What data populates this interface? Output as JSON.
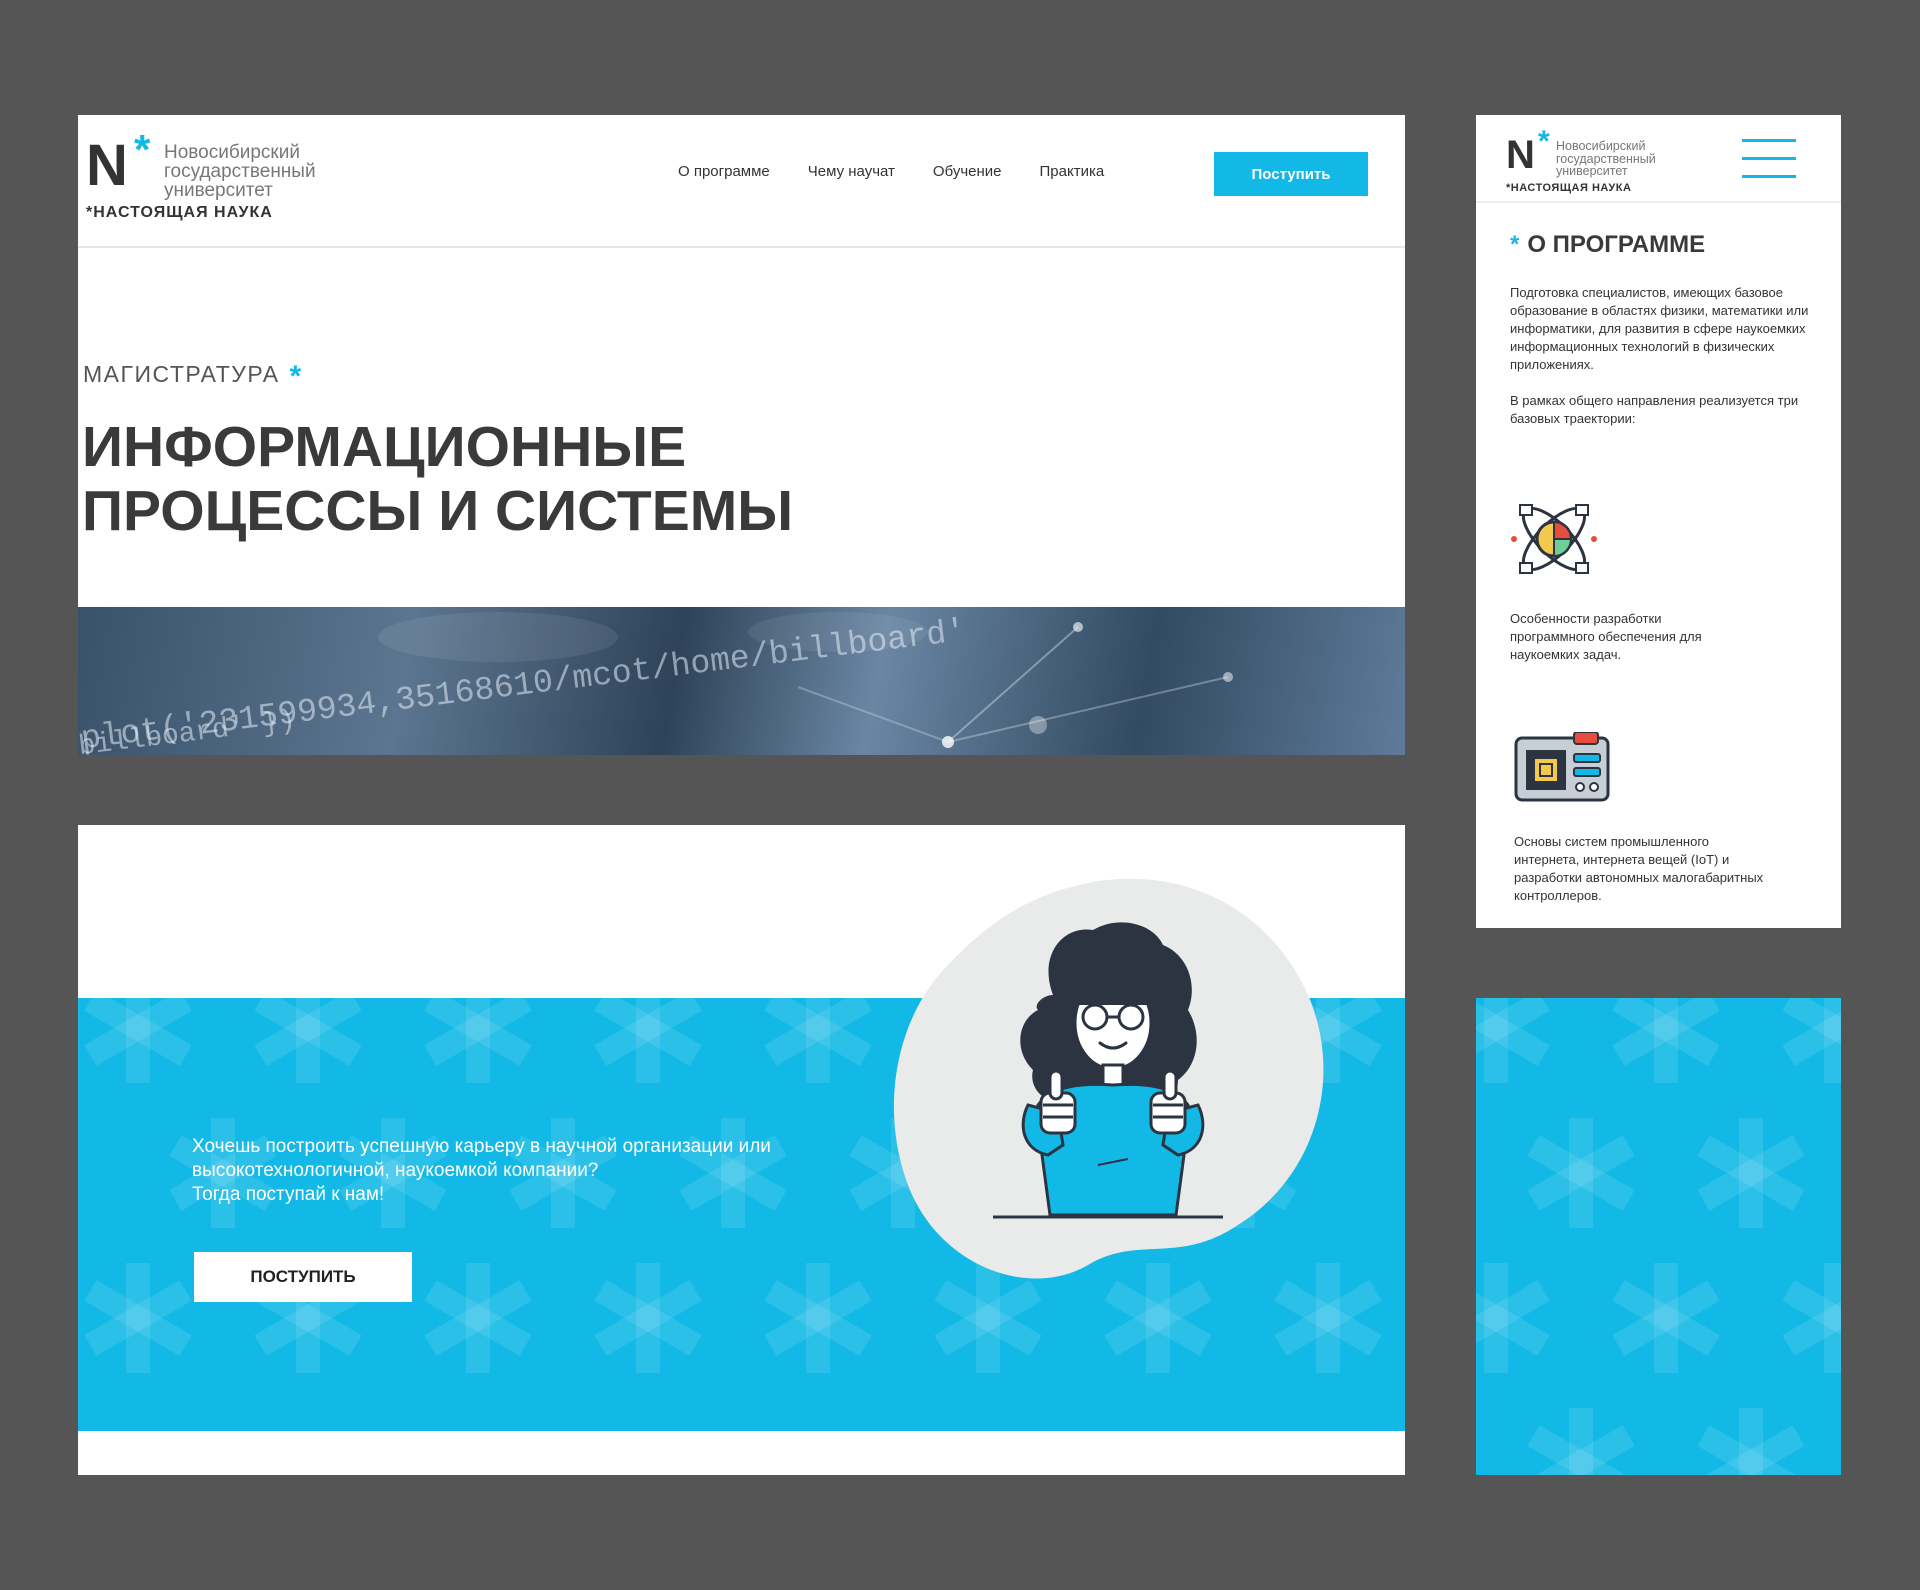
{
  "brand": {
    "logo_letter": "N",
    "logo_star": "*",
    "university_lines": [
      "Новосибирский",
      "государственный",
      "университет"
    ],
    "tagline": "*НАСТОЯЩАЯ НАУКА",
    "accent_color": "#13b9e6"
  },
  "desktop_header": {
    "nav": [
      "О программе",
      "Чему научат",
      "Обучение",
      "Практика"
    ],
    "apply_label": "Поступить"
  },
  "hero": {
    "kicker": "МАГИСТРАТУРА",
    "kicker_star": "*",
    "title_line1": "ИНФОРМАЦИОННЫЕ",
    "title_line2": "ПРОЦЕССЫ И СИСТЕМЫ",
    "code_line1": "plot('231599934,35168610/mcot/home/billboard'",
    "code_line2": "billboard' })"
  },
  "career": {
    "line1": "Хочешь построить успешную карьеру в научной организации или",
    "line2": "высокотехнологичной, наукоемкой компании?",
    "line3": "Тогда поступай к нам!",
    "button_label": "ПОСТУПИТЬ"
  },
  "mobile": {
    "section_star": "*",
    "section_title": "О ПРОГРАММЕ",
    "paragraph1": "Подготовка специалистов, имеющих базовое образование в областях физики, математики или информатики, для развития в сфере наукоемких информационных технологий в физических приложениях.",
    "paragraph2": "В рамках общего направления реализуется три базовых траектории:",
    "trajectories": [
      {
        "icon": "atom-chart-icon",
        "caption": "Особенности разработки программного обеспечения для наукоемких задач."
      },
      {
        "icon": "circuit-board-icon",
        "caption": "Основы систем промышленного интернета, интернета вещей (IoT) и разработки автономных малогабаритных контроллеров."
      }
    ]
  }
}
